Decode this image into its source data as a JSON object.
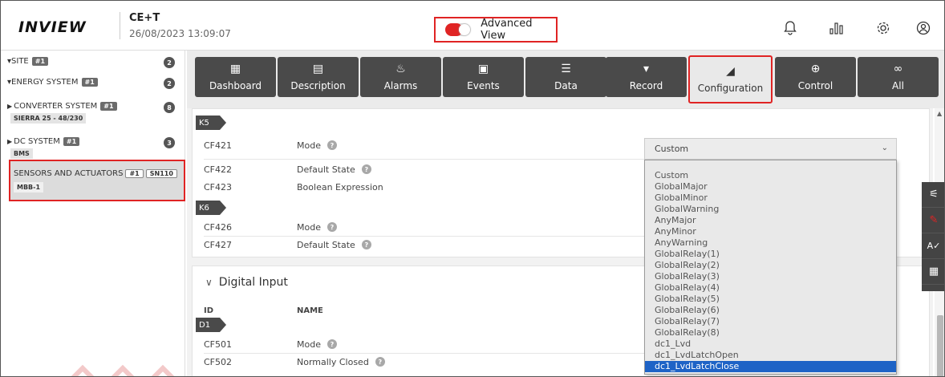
{
  "header": {
    "logo_text": "INVIEW",
    "site_name": "CE+T",
    "datetime": "26/08/2023 13:09:07",
    "advanced_view_label": "Advanced View",
    "advanced_view_on": true,
    "icons": [
      "bell-icon",
      "bar-chart-icon",
      "gear-icon",
      "user-icon"
    ]
  },
  "sidebar": {
    "items": [
      {
        "label": "SITE",
        "badge": "#1",
        "count": "2",
        "expanded": true
      },
      {
        "label": "ENERGY SYSTEM",
        "badge": "#1",
        "count": "2",
        "expanded": true
      },
      {
        "label": "CONVERTER SYSTEM",
        "badge": "#1",
        "count": "8",
        "subtag": "SIERRA 25 - 48/230",
        "expanded": false
      },
      {
        "label": "DC SYSTEM",
        "badge": "#1",
        "count": "3",
        "subtag": "BMS",
        "expanded": false
      },
      {
        "label": "SENSORS AND ACTUATORS",
        "badge": "#1",
        "badge2": "SN110",
        "subtag": "MBB-1",
        "selected": true
      }
    ]
  },
  "tabs": [
    {
      "label": "Dashboard",
      "icon": "dashboard-icon"
    },
    {
      "label": "Description",
      "icon": "document-icon"
    },
    {
      "label": "Alarms",
      "icon": "alarm-icon"
    },
    {
      "label": "Events",
      "icon": "calendar-icon"
    },
    {
      "label": "Data",
      "icon": "data-icon"
    },
    {
      "label": "Record",
      "icon": "record-icon"
    },
    {
      "label": "Configuration",
      "icon": "configuration-icon",
      "active": true
    },
    {
      "label": "Control",
      "icon": "control-icon"
    },
    {
      "label": "All",
      "icon": "infinity-icon"
    }
  ],
  "config": {
    "k5": {
      "tag": "K5",
      "rows": [
        {
          "id": "CF421",
          "name": "Mode"
        },
        {
          "id": "CF422",
          "name": "Default State"
        },
        {
          "id": "CF423",
          "name": "Boolean Expression"
        }
      ]
    },
    "k6": {
      "tag": "K6",
      "rows": [
        {
          "id": "CF426",
          "name": "Mode"
        },
        {
          "id": "CF427",
          "name": "Default State"
        }
      ]
    },
    "digital_input": {
      "title": "Digital Input",
      "col_id": "ID",
      "col_name": "NAME",
      "d1": {
        "tag": "D1",
        "rows": [
          {
            "id": "CF501",
            "name": "Mode"
          },
          {
            "id": "CF502",
            "name": "Normally Closed"
          }
        ]
      }
    }
  },
  "mode_select": {
    "value": "Custom",
    "options": [
      "Custom",
      "GlobalMajor",
      "GlobalMinor",
      "GlobalWarning",
      "AnyMajor",
      "AnyMinor",
      "AnyWarning",
      "GlobalRelay(1)",
      "GlobalRelay(2)",
      "GlobalRelay(3)",
      "GlobalRelay(4)",
      "GlobalRelay(5)",
      "GlobalRelay(6)",
      "GlobalRelay(7)",
      "GlobalRelay(8)",
      "dc1_Lvd",
      "dc1_LvdLatchOpen",
      "dc1_LvdLatchClose"
    ],
    "highlighted": "dc1_LvdLatchClose"
  },
  "right_tools": [
    "filter-icon",
    "pencil-icon",
    "spellcheck-icon",
    "grid-icon"
  ],
  "colors": {
    "accent": "#e02424",
    "dark": "#4a4a4a",
    "selection": "#1e63c6"
  }
}
